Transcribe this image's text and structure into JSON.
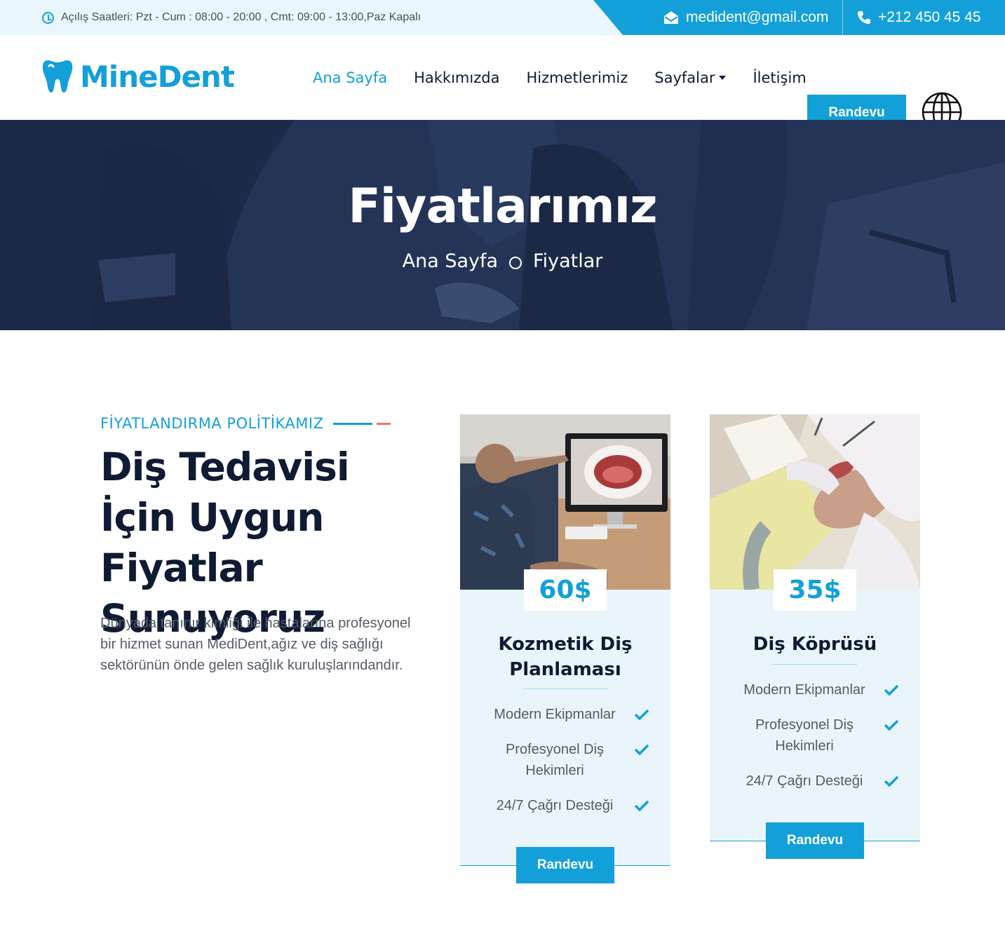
{
  "topbar": {
    "hours": "Açılış Saatleri: Pzt - Cum : 08:00 - 20:00 , Cmt: 09:00 - 13:00,Paz Kapalı",
    "email": "medident@gmail.com",
    "phone": "+212 450 45 45"
  },
  "brand": {
    "name": "MineDent",
    "color": "#13a0d8",
    "dark_color": "#0f1b33"
  },
  "nav": {
    "items": [
      {
        "label": "Ana Sayfa",
        "active": true
      },
      {
        "label": "Hakkımızda",
        "active": false
      },
      {
        "label": "Hizmetlerimiz",
        "active": false
      },
      {
        "label": "Sayfalar",
        "active": false,
        "dropdown": true
      },
      {
        "label": "İletişim",
        "active": false
      }
    ],
    "cta": "Randevu",
    "language_icon": "globe-icon"
  },
  "hero": {
    "title": "Fiyatlarımız",
    "breadcrumb": [
      "Ana Sayfa",
      "Fiyatlar"
    ]
  },
  "intro": {
    "subtitle": "FİYATLANDIRMA POLİTİKAMIZ",
    "heading": "Diş Tedavisi İçin Uygun Fiyatlar Sunuyoruz",
    "description": "Dünyada tanınır kimliği ile hastalarına profesyonel bir hizmet sunan MediDent,ağız ve diş sağlığı sektörünün önde gelen sağlık kuruluşlarındandır."
  },
  "plans": [
    {
      "price": "60$",
      "title": "Kozmetik Diş Planlaması",
      "features": [
        "Modern Ekipmanlar",
        "Profesyonel Diş Hekimleri",
        "24/7 Çağrı Desteği"
      ],
      "button": "Randevu"
    },
    {
      "price": "35$",
      "title": "Diş Köprüsü",
      "features": [
        "Modern Ekipmanlar",
        "Profesyonel Diş Hekimleri",
        "24/7 Çağrı Desteği"
      ],
      "button": "Randevu"
    }
  ]
}
